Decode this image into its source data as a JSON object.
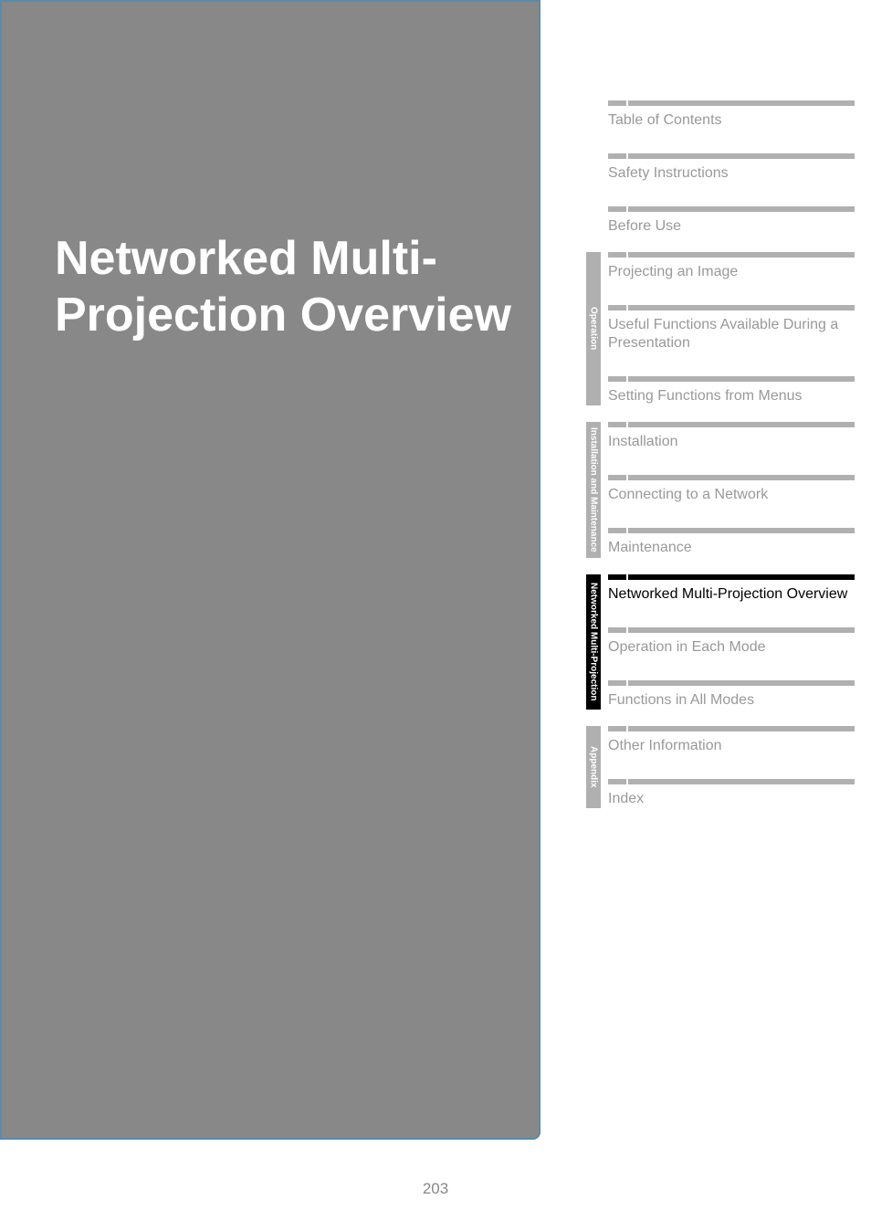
{
  "chapter_title": "Networked Multi-Projection Overview",
  "page_number": "203",
  "top_nav": [
    {
      "label": "Table of Contents"
    },
    {
      "label": "Safety Instructions"
    },
    {
      "label": "Before Use"
    }
  ],
  "sections": [
    {
      "tab": "Operation",
      "active": false,
      "items": [
        {
          "label": "Projecting an Image",
          "active": false
        },
        {
          "label": "Useful Functions Available During a Presentation",
          "active": false
        },
        {
          "label": "Setting Functions from Menus",
          "active": false
        }
      ]
    },
    {
      "tab": "Installation and Maintenance",
      "active": false,
      "items": [
        {
          "label": "Installation",
          "active": false
        },
        {
          "label": "Connecting to a Network",
          "active": false
        },
        {
          "label": "Maintenance",
          "active": false
        }
      ]
    },
    {
      "tab": "Networked Multi-Projection",
      "active": true,
      "items": [
        {
          "label": "Networked Multi-Projection Overview",
          "active": true
        },
        {
          "label": "Operation in Each Mode",
          "active": false
        },
        {
          "label": "Functions in All Modes",
          "active": false
        }
      ]
    },
    {
      "tab": "Appendix",
      "active": false,
      "items": [
        {
          "label": "Other Information",
          "active": false
        },
        {
          "label": "Index",
          "active": false
        }
      ]
    }
  ]
}
